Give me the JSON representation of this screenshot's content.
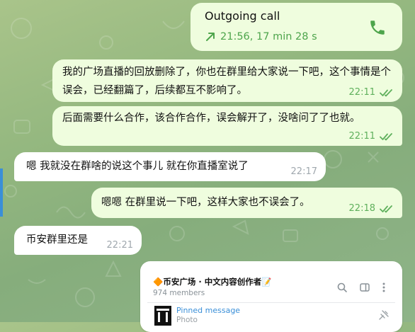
{
  "call": {
    "title": "Outgoing call",
    "details": "21:56, 17 min 28 s",
    "arrow_icon": "outgoing-arrow-icon",
    "action_icon": "phone-icon"
  },
  "messages": [
    {
      "direction": "out",
      "text": "我的广场直播的回放删除了，你也在群里给大家说一下吧，这个事情是个误会，已经翻篇了，后续都互不影响了。",
      "time": "22:11",
      "read": true
    },
    {
      "direction": "out",
      "text": "后面需要什么合作，该合作合作，误会解开了，没啥问了了也就。",
      "time": "22:11",
      "read": true
    },
    {
      "direction": "in",
      "text": "嗯  我就没在群啥的说这个事儿  就在你直播室说了",
      "time": "22:17"
    },
    {
      "direction": "out",
      "text": "嗯嗯  在群里说一下吧，这样大家也不误会了。",
      "time": "22:18",
      "read": true
    },
    {
      "direction": "in",
      "text": "币安群里还是",
      "time": "22:21"
    }
  ],
  "group_card": {
    "name": "🔶币安广场 · 中文内容创作者📝",
    "members": "974 members",
    "pinned_label": "Pinned message",
    "pinned_sub": "Photo",
    "icons": [
      "search-icon",
      "sidebar-icon",
      "more-icon",
      "pin-icon"
    ]
  },
  "colors": {
    "outgoing_bubble": "#effdde",
    "incoming_bubble": "#ffffff",
    "accent_green": "#4ea54c",
    "link_blue": "#3a8fd8"
  }
}
